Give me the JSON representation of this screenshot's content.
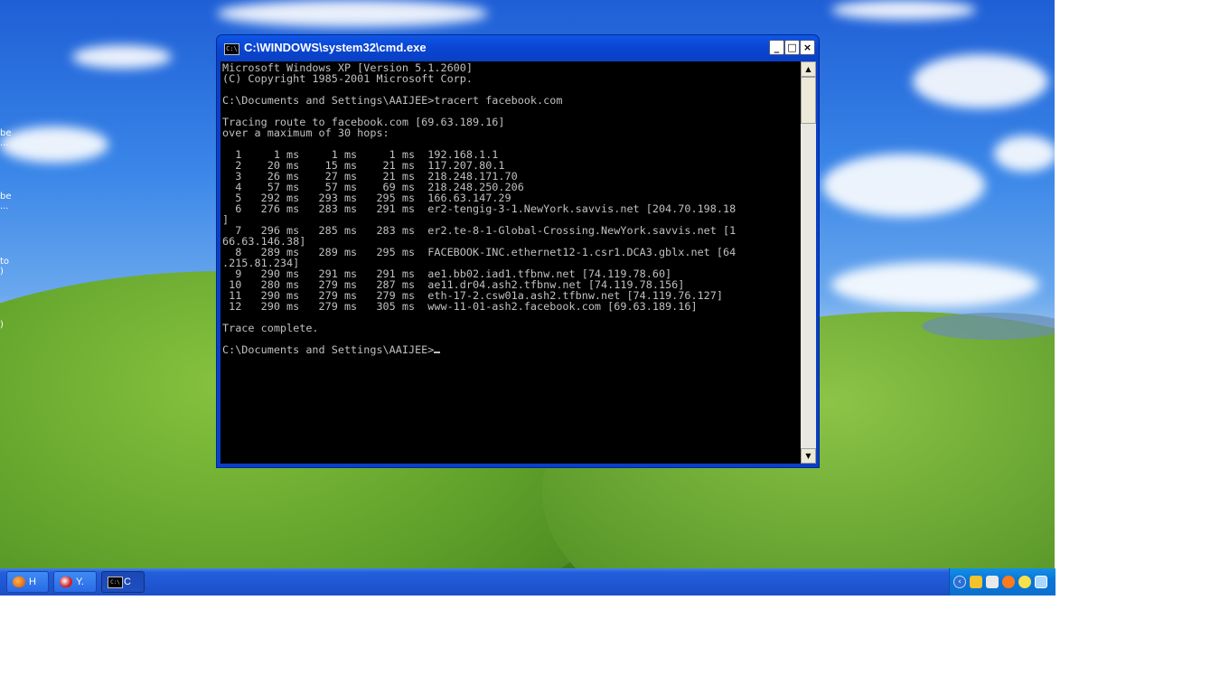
{
  "window": {
    "title": "C:\\WINDOWS\\system32\\cmd.exe",
    "icon_label": "C:\\",
    "minimize": "_",
    "maximize": "□",
    "close": "×"
  },
  "console": {
    "text": "Microsoft Windows XP [Version 5.1.2600]\n(C) Copyright 1985-2001 Microsoft Corp.\n\nC:\\Documents and Settings\\AAIJEE>tracert facebook.com\n\nTracing route to facebook.com [69.63.189.16]\nover a maximum of 30 hops:\n\n  1     1 ms     1 ms     1 ms  192.168.1.1\n  2    20 ms    15 ms    21 ms  117.207.80.1\n  3    26 ms    27 ms    21 ms  218.248.171.70\n  4    57 ms    57 ms    69 ms  218.248.250.206\n  5   292 ms   293 ms   295 ms  166.63.147.29\n  6   276 ms   283 ms   291 ms  er2-tengig-3-1.NewYork.savvis.net [204.70.198.18\n]\n  7   296 ms   285 ms   283 ms  er2.te-8-1-Global-Crossing.NewYork.savvis.net [1\n66.63.146.38]\n  8   289 ms   289 ms   295 ms  FACEBOOK-INC.ethernet12-1.csr1.DCA3.gblx.net [64\n.215.81.234]\n  9   290 ms   291 ms   291 ms  ae1.bb02.iad1.tfbnw.net [74.119.78.60]\n 10   280 ms   279 ms   287 ms  ae11.dr04.ash2.tfbnw.net [74.119.78.156]\n 11   290 ms   279 ms   279 ms  eth-17-2.csw01a.ash2.tfbnw.net [74.119.76.127]\n 12   290 ms   279 ms   305 ms  www-11-01-ash2.facebook.com [69.63.189.16]\n\nTrace complete.\n\nC:\\Documents and Settings\\AAIJEE>"
  },
  "scrollbar": {
    "up": "▲",
    "down": "▼"
  },
  "desktop_icons": [
    {
      "label": "be\n..."
    },
    {
      "label": "be\n..."
    },
    {
      "label": "to\n)"
    },
    {
      "label": ")"
    }
  ],
  "taskbar": {
    "buttons": [
      {
        "label": "H",
        "icon": "firefox-icon"
      },
      {
        "label": "Y.",
        "icon": "browser-icon"
      },
      {
        "label": "C",
        "icon": "cmd-icon",
        "icon_text": "C:\\"
      }
    ],
    "tray": {
      "chevron": "‹"
    }
  }
}
